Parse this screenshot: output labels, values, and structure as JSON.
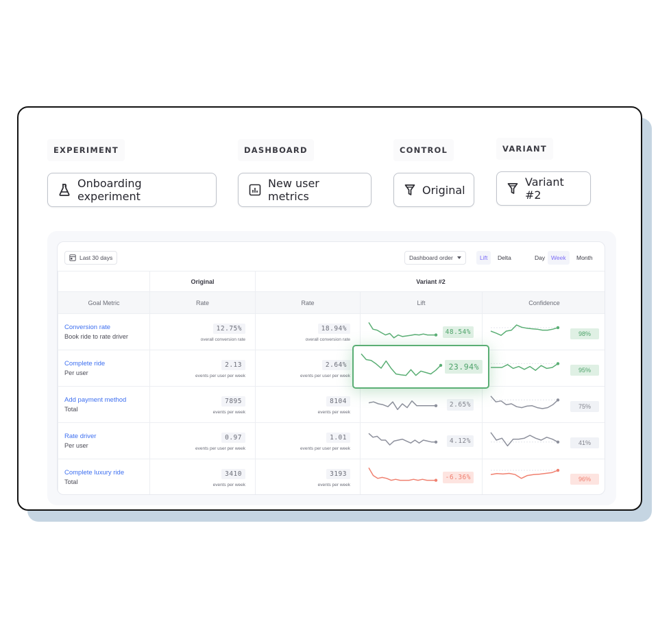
{
  "selectors": [
    {
      "label": "EXPERIMENT",
      "value": "Onboarding experiment",
      "icon": "flask-icon"
    },
    {
      "label": "DASHBOARD",
      "value": "New user metrics",
      "icon": "bar-chart-icon"
    },
    {
      "label": "CONTROL",
      "value": "Original",
      "icon": "funnel-icon"
    },
    {
      "label": "VARIANT",
      "value": "Variant #2",
      "icon": "funnel-icon"
    }
  ],
  "toolbar": {
    "date_range": "Last 30 days",
    "date_icon": "calendar-icon",
    "sort_order": "Dashboard order",
    "metric_toggle": {
      "options": [
        "Lift",
        "Delta"
      ],
      "selected": "Lift"
    },
    "period_toggle": {
      "options": [
        "Day",
        "Week",
        "Month"
      ],
      "selected": "Week"
    }
  },
  "table": {
    "group_headers": {
      "control": "Original",
      "variant": "Variant #2"
    },
    "columns": [
      "Goal Metric",
      "Rate",
      "Rate",
      "Lift",
      "Confidence"
    ],
    "rows": [
      {
        "name": "Conversion rate",
        "sub": "Book ride to rate driver",
        "original_rate": "12.75%",
        "original_desc": "overall conversion rate",
        "variant_rate": "18.94%",
        "variant_desc": "overall conversion rate",
        "lift": "48.54%",
        "confidence": "98%",
        "status": "positive"
      },
      {
        "name": "Complete ride",
        "sub": "Per user",
        "original_rate": "2.13",
        "original_desc": "events per user per week",
        "variant_rate": "2.64%",
        "variant_desc": "events per user per week",
        "lift": "23.94%",
        "confidence": "95%",
        "status": "positive",
        "highlighted": true
      },
      {
        "name": "Add payment method",
        "sub": "Total",
        "original_rate": "7895",
        "original_desc": "events per week",
        "variant_rate": "8104",
        "variant_desc": "events per week",
        "lift": "2.65%",
        "confidence": "75%",
        "status": "neutral"
      },
      {
        "name": "Rate driver",
        "sub": "Per user",
        "original_rate": "0.97",
        "original_desc": "events per user per week",
        "variant_rate": "1.01",
        "variant_desc": "events per user per week",
        "lift": "4.12%",
        "confidence": "41%",
        "status": "neutral"
      },
      {
        "name": "Complete luxury ride",
        "sub": "Total",
        "original_rate": "3410",
        "original_desc": "events per week",
        "variant_rate": "3193",
        "variant_desc": "events per week",
        "lift": "-6.36%",
        "confidence": "96%",
        "status": "negative"
      }
    ]
  },
  "sparklines": {
    "lift": [
      [
        0.95,
        0.6,
        0.55,
        0.42,
        0.3,
        0.38,
        0.15,
        0.3,
        0.22,
        0.25,
        0.28,
        0.32,
        0.3,
        0.35,
        0.3,
        0.3,
        0.3
      ],
      [
        0.95,
        0.75,
        0.72,
        0.6,
        0.45,
        0.7,
        0.45,
        0.25,
        0.22,
        0.2,
        0.4,
        0.2,
        0.35,
        0.3,
        0.25,
        0.38,
        0.55
      ],
      [
        0.55,
        0.6,
        0.5,
        0.45,
        0.35,
        0.6,
        0.2,
        0.5,
        0.3,
        0.65,
        0.4,
        0.4,
        0.4,
        0.4,
        0.4
      ],
      [
        0.85,
        0.65,
        0.7,
        0.5,
        0.5,
        0.25,
        0.45,
        0.5,
        0.55,
        0.45,
        0.35,
        0.5,
        0.35,
        0.5,
        0.45,
        0.4,
        0.4
      ],
      [
        0.95,
        0.55,
        0.4,
        0.45,
        0.4,
        0.3,
        0.35,
        0.3,
        0.3,
        0.3,
        0.35,
        0.3,
        0.35,
        0.3,
        0.3,
        0.3
      ]
    ],
    "confidence": [
      [
        0.5,
        0.4,
        0.28,
        0.5,
        0.55,
        0.82,
        0.7,
        0.65,
        0.62,
        0.6,
        0.55,
        0.55,
        0.6,
        0.68
      ],
      [
        0.5,
        0.5,
        0.5,
        0.65,
        0.45,
        0.55,
        0.4,
        0.55,
        0.35,
        0.6,
        0.45,
        0.5,
        0.7
      ],
      [
        0.9,
        0.6,
        0.65,
        0.45,
        0.5,
        0.35,
        0.3,
        0.38,
        0.4,
        0.3,
        0.25,
        0.3,
        0.45,
        0.7
      ],
      [
        0.9,
        0.5,
        0.6,
        0.2,
        0.55,
        0.55,
        0.6,
        0.75,
        0.6,
        0.5,
        0.65,
        0.55,
        0.4
      ],
      [
        0.6,
        0.65,
        0.63,
        0.66,
        0.6,
        0.4,
        0.55,
        0.6,
        0.62,
        0.66,
        0.7,
        0.82
      ]
    ]
  },
  "colors": {
    "positive": "#5aae74",
    "neutral": "#8d909c",
    "negative": "#f0806f",
    "link": "#3d6ff0",
    "toggle_active": "#7b6cf6"
  }
}
